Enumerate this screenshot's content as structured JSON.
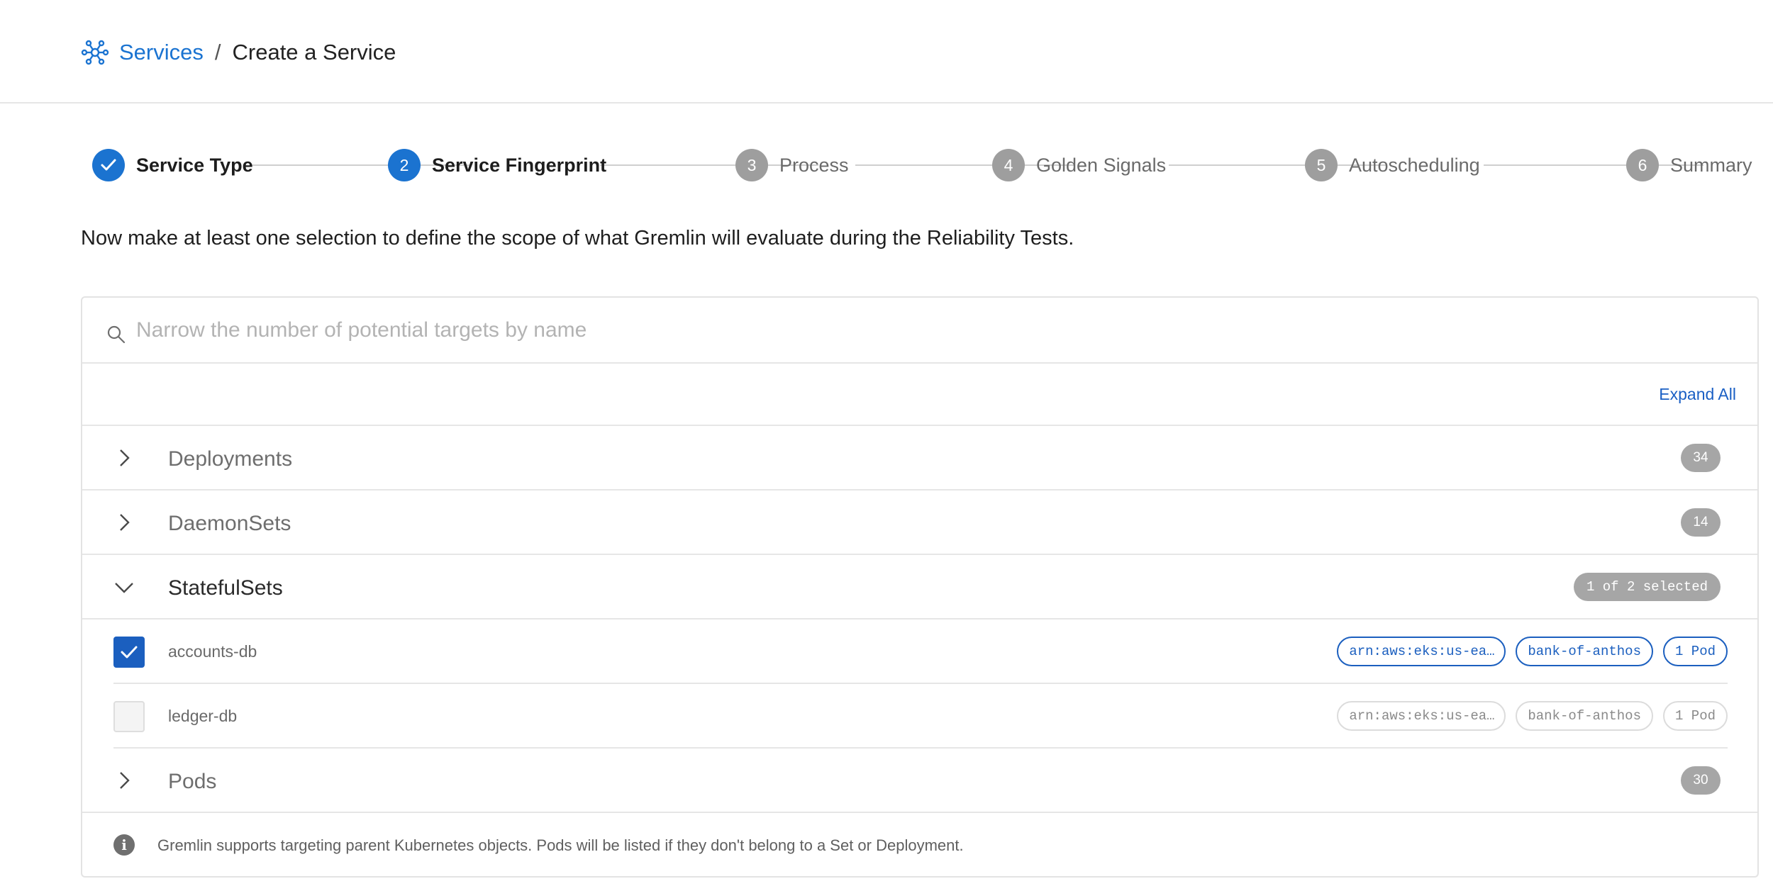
{
  "breadcrumb": {
    "icon": "services-network-icon",
    "parent": "Services",
    "separator": "/",
    "current": "Create a Service"
  },
  "stepper": {
    "steps": [
      {
        "number": "",
        "label": "Service Type",
        "state": "done"
      },
      {
        "number": "2",
        "label": "Service Fingerprint",
        "state": "active"
      },
      {
        "number": "3",
        "label": "Process",
        "state": "pending"
      },
      {
        "number": "4",
        "label": "Golden Signals",
        "state": "pending"
      },
      {
        "number": "5",
        "label": "Autoscheduling",
        "state": "pending"
      },
      {
        "number": "6",
        "label": "Summary",
        "state": "pending"
      }
    ]
  },
  "intro": "Now make at least one selection to define the scope of what Gremlin will evaluate during the Reliability Tests.",
  "search": {
    "placeholder": "Narrow the number of potential targets by name",
    "value": ""
  },
  "expand_all": "Expand All",
  "groups": {
    "deployments": {
      "label": "Deployments",
      "count": "34",
      "expanded": false
    },
    "daemonsets": {
      "label": "DaemonSets",
      "count": "14",
      "expanded": false
    },
    "statefulsets": {
      "label": "StatefulSets",
      "badge": "1 of 2 selected",
      "expanded": true
    },
    "pods": {
      "label": "Pods",
      "count": "30",
      "expanded": false
    }
  },
  "statefulset_items": [
    {
      "name": "accounts-db",
      "checked": true,
      "tags": [
        "arn:aws:eks:us-ea…",
        "bank-of-anthos",
        "1 Pod"
      ]
    },
    {
      "name": "ledger-db",
      "checked": false,
      "tags": [
        "arn:aws:eks:us-ea…",
        "bank-of-anthos",
        "1 Pod"
      ]
    }
  ],
  "info": "Gremlin supports targeting parent Kubernetes objects. Pods will be listed if they don't belong to a Set or Deployment.",
  "colors": {
    "accent": "#1b73d0",
    "checkbox_checked": "#1b5fbf",
    "badge_gray": "#a6a6a6",
    "step_pending": "#9e9e9e"
  }
}
